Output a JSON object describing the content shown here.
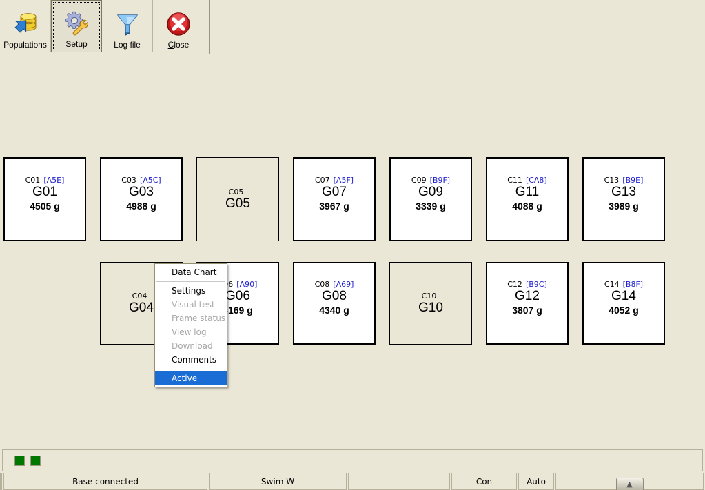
{
  "toolbar": {
    "buttons": [
      {
        "label": "Populations",
        "icon": "database-arrow-icon",
        "pressed": false,
        "accel": ""
      },
      {
        "label": "Setup",
        "icon": "gear-wrench-icon",
        "pressed": true,
        "accel": ""
      },
      {
        "label": "Log file",
        "icon": "funnel-icon",
        "pressed": false,
        "accel": ""
      },
      {
        "label": "Close",
        "icon": "red-circle-x-icon",
        "pressed": false,
        "accel": "C"
      }
    ]
  },
  "grid": {
    "row1": [
      {
        "channel": "C01",
        "hex": "[A5E]",
        "id": "G01",
        "weight": "4505 g",
        "active": true
      },
      {
        "channel": "C03",
        "hex": "[A5C]",
        "id": "G03",
        "weight": "4988 g",
        "active": true
      },
      {
        "channel": "C05",
        "hex": "",
        "id": "G05",
        "weight": "",
        "active": false
      },
      {
        "channel": "C07",
        "hex": "[A5F]",
        "id": "G07",
        "weight": "3967 g",
        "active": true
      },
      {
        "channel": "C09",
        "hex": "[B9F]",
        "id": "G09",
        "weight": "3339 g",
        "active": true
      },
      {
        "channel": "C11",
        "hex": "[CA8]",
        "id": "G11",
        "weight": "4088 g",
        "active": true
      },
      {
        "channel": "C13",
        "hex": "[B9E]",
        "id": "G13",
        "weight": "3989 g",
        "active": true
      }
    ],
    "row2": [
      {
        "channel": "C04",
        "hex": "",
        "id": "G04",
        "weight": "",
        "active": false
      },
      {
        "channel": "C06",
        "hex": "[A90]",
        "id": "G06",
        "weight": "4169 g",
        "active": true
      },
      {
        "channel": "C08",
        "hex": "[A69]",
        "id": "G08",
        "weight": "4340 g",
        "active": true
      },
      {
        "channel": "C10",
        "hex": "",
        "id": "G10",
        "weight": "",
        "active": false
      },
      {
        "channel": "C12",
        "hex": "[B9C]",
        "id": "G12",
        "weight": "3807 g",
        "active": true
      },
      {
        "channel": "C14",
        "hex": "[B8F]",
        "id": "G14",
        "weight": "4052 g",
        "active": true
      }
    ]
  },
  "context_menu": {
    "items": [
      {
        "label": "Data Chart",
        "disabled": false,
        "selected": false,
        "separator_after": true
      },
      {
        "label": "Settings",
        "disabled": false,
        "selected": false,
        "separator_after": false
      },
      {
        "label": "Visual test",
        "disabled": true,
        "selected": false,
        "separator_after": false
      },
      {
        "label": "Frame status",
        "disabled": true,
        "selected": false,
        "separator_after": false
      },
      {
        "label": "View log",
        "disabled": true,
        "selected": false,
        "separator_after": false
      },
      {
        "label": "Download",
        "disabled": true,
        "selected": false,
        "separator_after": false
      },
      {
        "label": "Comments",
        "disabled": false,
        "selected": false,
        "separator_after": true
      },
      {
        "label": "Active",
        "disabled": false,
        "selected": true,
        "separator_after": false
      }
    ]
  },
  "led_bar": {
    "leds": [
      {
        "name": "led-1",
        "color": "#007800"
      },
      {
        "name": "led-2",
        "color": "#007800"
      }
    ]
  },
  "status_bar": {
    "blank1": "",
    "base": "Base connected",
    "swim": "Swim W",
    "blank2": "",
    "con": "Con",
    "auto": "Auto",
    "expand_glyph": "«"
  }
}
